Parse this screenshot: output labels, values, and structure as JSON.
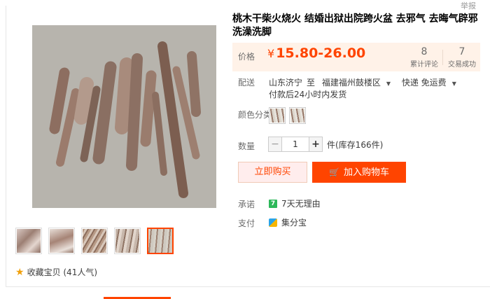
{
  "header": {
    "report": "举报"
  },
  "product": {
    "title": "桃木干柴火烧火 结婚出狱出院跨火盆 去邪气 去晦气辟邪洗澡洗脚"
  },
  "price": {
    "label": "价格",
    "currency": "¥",
    "range": "15.80-26.00",
    "reviews_count": "8",
    "reviews_label": "累计评论",
    "sales_count": "7",
    "sales_label": "交易成功"
  },
  "shipping": {
    "label": "配送",
    "from": "山东济宁",
    "to_word": "至",
    "destination": "福建福州鼓楼区",
    "method": "快递 免运费",
    "dispatch": "付款后24小时内发货"
  },
  "color": {
    "label": "颜色分类",
    "options": [
      "option-1",
      "option-2"
    ]
  },
  "quantity": {
    "label": "数量",
    "value": "1",
    "stock": "件(库存166件)"
  },
  "actions": {
    "buy_now": "立即购买",
    "add_to_cart": "加入购物车"
  },
  "promise": {
    "label": "承诺",
    "text": "7天无理由",
    "icon_text": "7"
  },
  "payment": {
    "label": "支付",
    "text": "集分宝"
  },
  "favorite": {
    "text": "收藏宝贝 (41人气)"
  },
  "colors": {
    "accent": "#ff4400",
    "price_bg": "#fff2e8",
    "buy_bg": "#ffeded"
  },
  "icons": [
    "star-icon",
    "cart-icon",
    "seven-day-icon",
    "jifenbao-icon",
    "caret-down-icon",
    "minus-icon",
    "plus-icon"
  ]
}
